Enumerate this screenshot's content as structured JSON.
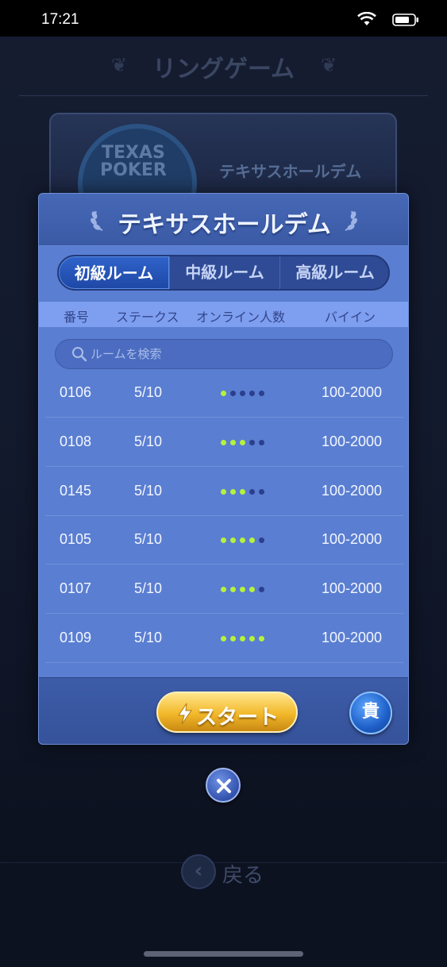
{
  "status_bar": {
    "time": "17:21"
  },
  "background": {
    "page_title": "リングゲーム",
    "card_logo_line1": "TEXAS",
    "card_logo_line2": "POKER",
    "card_game_name": "テキサスホールデム",
    "back_label": "戻る"
  },
  "modal": {
    "title": "テキサスホールデム",
    "tabs": [
      {
        "label": "初級ルーム",
        "selected": true
      },
      {
        "label": "中級ルーム",
        "selected": false
      },
      {
        "label": "高級ルーム",
        "selected": false
      }
    ],
    "columns": {
      "number": "番号",
      "stakes": "ステークス",
      "online": "オンライン人数",
      "buyin": "バイイン"
    },
    "search": {
      "placeholder": "ルームを検索",
      "value": ""
    },
    "rooms": [
      {
        "number": "0106",
        "stakes": "5/10",
        "occupancy": 1,
        "buyin": "100-2000"
      },
      {
        "number": "0108",
        "stakes": "5/10",
        "occupancy": 3,
        "buyin": "100-2000"
      },
      {
        "number": "0145",
        "stakes": "5/10",
        "occupancy": 3,
        "buyin": "100-2000"
      },
      {
        "number": "0105",
        "stakes": "5/10",
        "occupancy": 4,
        "buyin": "100-2000"
      },
      {
        "number": "0107",
        "stakes": "5/10",
        "occupancy": 4,
        "buyin": "100-2000"
      },
      {
        "number": "0109",
        "stakes": "5/10",
        "occupancy": 5,
        "buyin": "100-2000"
      }
    ],
    "occupancy_max": 5,
    "start_label": "スタート",
    "vip_label": "貴"
  },
  "colors": {
    "occupied_dot": "#b6f23a",
    "empty_dot": "#2c3f8f",
    "modal_body": "#5a7ed1",
    "start_gold": "#f2b82a"
  }
}
